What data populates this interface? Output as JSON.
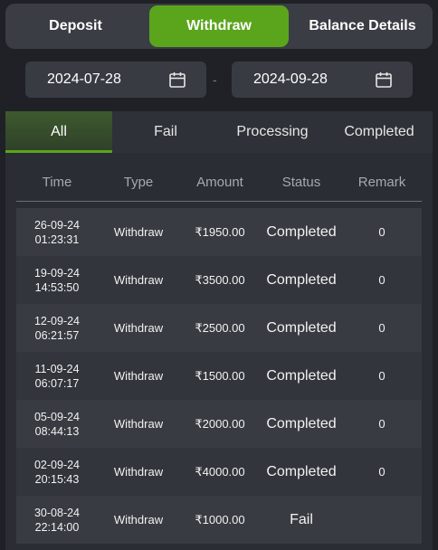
{
  "tabs": [
    {
      "label": "Deposit",
      "active": false
    },
    {
      "label": "Withdraw",
      "active": true
    },
    {
      "label": "Balance Details",
      "active": false
    }
  ],
  "date_range": {
    "start": "2024-07-28",
    "separator": "-",
    "end": "2024-09-28",
    "icon": "calendar-icon"
  },
  "status_tabs": [
    {
      "label": "All",
      "active": true
    },
    {
      "label": "Fail",
      "active": false
    },
    {
      "label": "Processing",
      "active": false
    },
    {
      "label": "Completed",
      "active": false
    }
  ],
  "table": {
    "headers": [
      "Time",
      "Type",
      "Amount",
      "Status",
      "Remark"
    ],
    "rows": [
      {
        "date": "26-09-24",
        "time": "01:23:31",
        "type": "Withdraw",
        "amount": "₹1950.00",
        "status": "Completed",
        "remark": "0"
      },
      {
        "date": "19-09-24",
        "time": "14:53:50",
        "type": "Withdraw",
        "amount": "₹3500.00",
        "status": "Completed",
        "remark": "0"
      },
      {
        "date": "12-09-24",
        "time": "06:21:57",
        "type": "Withdraw",
        "amount": "₹2500.00",
        "status": "Completed",
        "remark": "0"
      },
      {
        "date": "11-09-24",
        "time": "06:07:17",
        "type": "Withdraw",
        "amount": "₹1500.00",
        "status": "Completed",
        "remark": "0"
      },
      {
        "date": "05-09-24",
        "time": "08:44:13",
        "type": "Withdraw",
        "amount": "₹2000.00",
        "status": "Completed",
        "remark": "0"
      },
      {
        "date": "02-09-24",
        "time": "20:15:43",
        "type": "Withdraw",
        "amount": "₹4000.00",
        "status": "Completed",
        "remark": "0"
      },
      {
        "date": "30-08-24",
        "time": "22:14:00",
        "type": "Withdraw",
        "amount": "₹1000.00",
        "status": "Fail",
        "remark": ""
      }
    ]
  },
  "colors": {
    "accent": "#5aa51c",
    "background": "#1f2126"
  }
}
